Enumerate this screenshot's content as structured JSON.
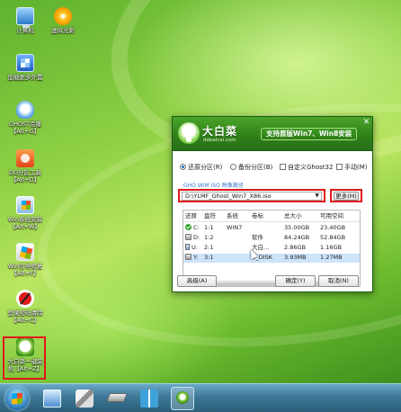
{
  "desktop": {
    "icons": [
      {
        "label": "计算机",
        "icon": "computer-icon"
      },
      {
        "label": "虚拟光驱",
        "icon": "virtual-cd-icon"
      },
      {
        "label": "加载更多外置",
        "icon": "load-more-icon"
      },
      {
        "label": "GHOST克隆\n【Alt+G】",
        "icon": "ghost-icon"
      },
      {
        "label": "DG分区工具\n【Alt+D】",
        "icon": "diskgenius-icon"
      },
      {
        "label": "Win系统安装\n【Alt+W】",
        "icon": "windows-setup-icon"
      },
      {
        "label": "Win引导修复\n【Alt+F】",
        "icon": "boot-repair-icon"
      },
      {
        "label": "登录密码清除\n【Alt+C】",
        "icon": "password-clear-icon"
      },
      {
        "label": "大白菜一键装\n机【Alt+Z】",
        "icon": "dabaicai-installer-icon"
      }
    ]
  },
  "dialog": {
    "brand_name": "大白菜",
    "brand_url": "dabaicai.com",
    "tagline": "支持原版Win7、Win8安装",
    "close_glyph": "✕",
    "options": {
      "restore": "还原分区(R)",
      "backup": "备份分区(B)",
      "custom_ghost": "自定义Ghost32",
      "manual": "手动(M)"
    },
    "selected_option": "restore",
    "path_label": "GHO WIM ISO 映像路径",
    "path_value": "D:\\YLMF_Ghost_Win7_X86.iso",
    "more_button": "更多(M)",
    "table": {
      "headers": [
        "还原",
        "盘符",
        "系统",
        "卷标",
        "总大小",
        "可用空间"
      ],
      "rows": [
        {
          "drive": "C:",
          "num": "1:1",
          "system": "WIN7",
          "label": "",
          "total": "35.00GB",
          "free": "23.40GB",
          "icon": "selected-drive-icon"
        },
        {
          "drive": "D:",
          "num": "1:2",
          "system": "",
          "label": "软件",
          "total": "84.24GB",
          "free": "52.84GB",
          "icon": "hard-drive-icon"
        },
        {
          "drive": "U:",
          "num": "2:1",
          "system": "",
          "label": "大白...",
          "total": "2.86GB",
          "free": "1.16GB",
          "icon": "usb-drive-icon"
        },
        {
          "drive": "Y:",
          "num": "3:1",
          "system": "",
          "label": "V_DISK",
          "total": "3.93MB",
          "free": "1.27MB",
          "icon": "hard-drive-icon"
        }
      ]
    },
    "advanced_button": "高级(A)",
    "ok_button": "确定(Y)",
    "cancel_button": "取消(N)"
  },
  "taskbar": {
    "items": [
      "start-button",
      "screen-app-icon",
      "tools-app-icon",
      "drive-app-icon",
      "book-app-icon",
      "dabaicai-task-icon"
    ]
  },
  "colors": {
    "highlight": "#e0181a",
    "header_green": "#2f7f18",
    "path_label_blue": "#3b79c9"
  }
}
